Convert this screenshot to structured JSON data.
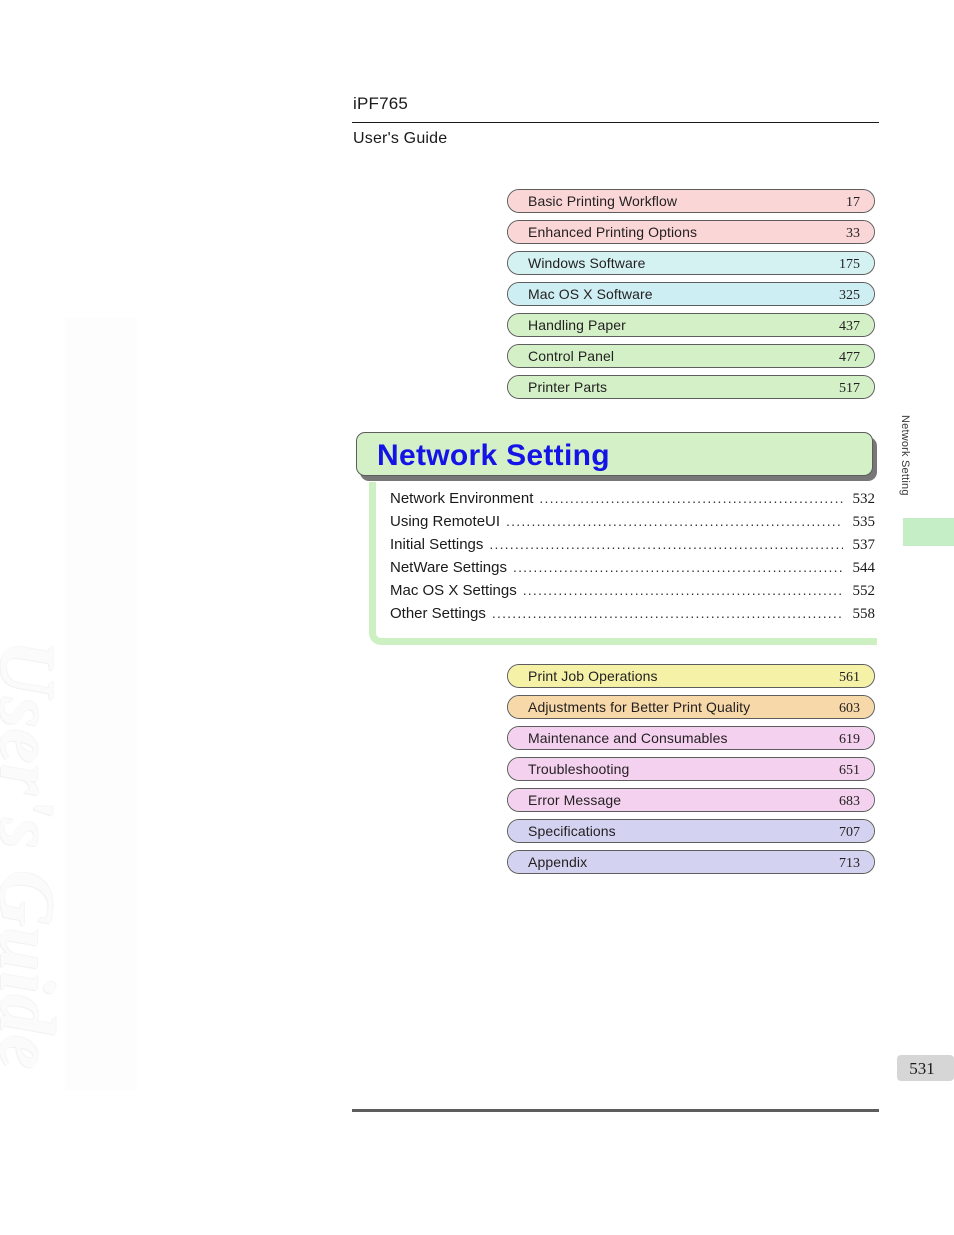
{
  "document": {
    "model": "iPF765",
    "guide_title": "User's Guide",
    "watermark": "User's Guide",
    "page_number": "531"
  },
  "side_tab": {
    "label": "Network Setting",
    "marker_color": "#c6eec6"
  },
  "chapters_top": [
    {
      "label": "Basic Printing Workflow",
      "page": "17",
      "color": "#fad6d6"
    },
    {
      "label": "Enhanced Printing Options",
      "page": "33",
      "color": "#fad6d6"
    },
    {
      "label": "Windows Software",
      "page": "175",
      "color": "#d4f2f2"
    },
    {
      "label": "Mac OS X Software",
      "page": "325",
      "color": "#cdeef2"
    },
    {
      "label": "Handling Paper",
      "page": "437",
      "color": "#d3f0c7"
    },
    {
      "label": "Control Panel",
      "page": "477",
      "color": "#d3f0c7"
    },
    {
      "label": "Printer Parts",
      "page": "517",
      "color": "#d3f0c7"
    }
  ],
  "current_chapter": {
    "title": "Network Setting",
    "title_color": "#1414e6",
    "background_color": "#d3f0c7",
    "accent_color": "#cdf0c2",
    "sections": [
      {
        "name": "Network Environment",
        "page": "532"
      },
      {
        "name": "Using RemoteUI",
        "page": "535"
      },
      {
        "name": "Initial Settings",
        "page": "537"
      },
      {
        "name": "NetWare Settings",
        "page": "544"
      },
      {
        "name": "Mac OS X Settings",
        "page": "552"
      },
      {
        "name": "Other Settings",
        "page": "558"
      }
    ]
  },
  "chapters_bottom": [
    {
      "label": "Print Job Operations",
      "page": "561",
      "color": "#f5f2a8"
    },
    {
      "label": "Adjustments for Better Print Quality",
      "page": "603",
      "color": "#f7d8a8"
    },
    {
      "label": "Maintenance and Consumables",
      "page": "619",
      "color": "#f4d2ef"
    },
    {
      "label": "Troubleshooting",
      "page": "651",
      "color": "#f4d2ef"
    },
    {
      "label": "Error Message",
      "page": "683",
      "color": "#f4d2ef"
    },
    {
      "label": "Specifications",
      "page": "707",
      "color": "#d3d2f0"
    },
    {
      "label": "Appendix",
      "page": "713",
      "color": "#d3d2f0"
    }
  ]
}
